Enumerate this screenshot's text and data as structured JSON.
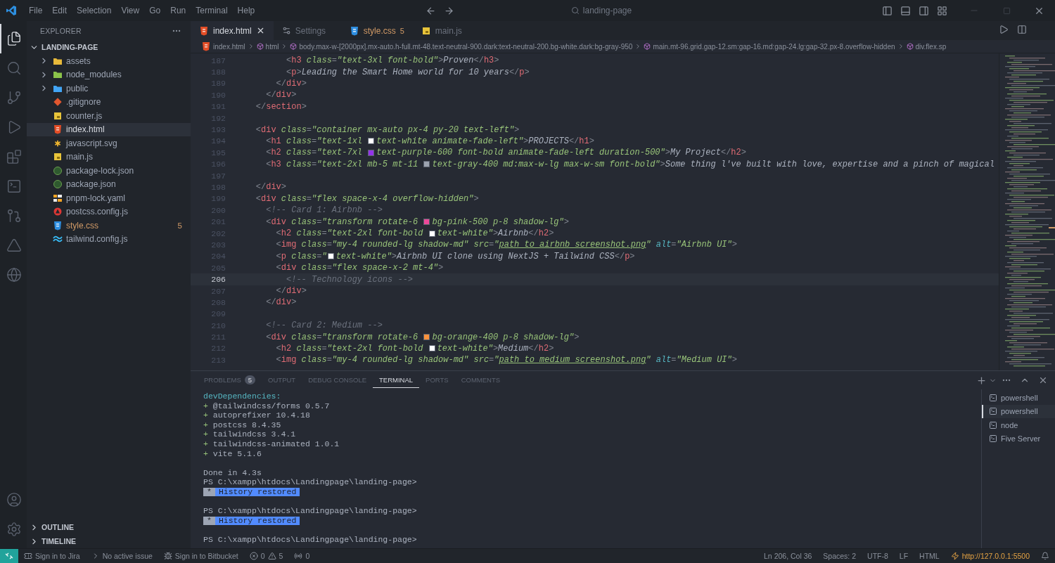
{
  "title_bar": {
    "menu": [
      "File",
      "Edit",
      "Selection",
      "View",
      "Go",
      "Run",
      "Terminal",
      "Help"
    ],
    "search": "landing-page"
  },
  "activity_bar": {
    "items": [
      {
        "selected": true
      },
      {
        "selected": false
      },
      {
        "selected": false
      },
      {
        "selected": false
      },
      {
        "selected": false
      },
      {
        "selected": false
      },
      {
        "selected": false
      },
      {
        "selected": false
      },
      {
        "selected": false
      }
    ]
  },
  "sidebar": {
    "title": "EXPLORER",
    "folder": {
      "name": "LANDING-PAGE",
      "expanded": true
    },
    "files": [
      {
        "kind": "folder",
        "name": "assets",
        "color": "#e8b93a",
        "expanded": false,
        "selected": false,
        "warning": false
      },
      {
        "kind": "folder",
        "name": "node_modules",
        "color": "#8bc34a",
        "expanded": false,
        "selected": false,
        "warning": false
      },
      {
        "kind": "folder",
        "name": "public",
        "color": "#42a5f5",
        "expanded": false,
        "selected": false,
        "warning": false
      },
      {
        "kind": "git",
        "name": ".gitignore",
        "selected": false,
        "warning": false
      },
      {
        "kind": "js",
        "name": "counter.js",
        "selected": false,
        "warning": false
      },
      {
        "kind": "html",
        "name": "index.html",
        "selected": true,
        "warning": false
      },
      {
        "kind": "svg",
        "name": "javascript.svg",
        "selected": false,
        "warning": false
      },
      {
        "kind": "js",
        "name": "main.js",
        "selected": false,
        "warning": false
      },
      {
        "kind": "json",
        "name": "package-lock.json",
        "selected": false,
        "warning": false
      },
      {
        "kind": "json",
        "name": "package.json",
        "selected": false,
        "warning": false
      },
      {
        "kind": "yaml",
        "name": "pnpm-lock.yaml",
        "selected": false,
        "warning": false
      },
      {
        "kind": "postcss",
        "name": "postcss.config.js",
        "selected": false,
        "warning": false
      },
      {
        "kind": "css",
        "name": "style.css",
        "badge": "5",
        "selected": false,
        "warning": true
      },
      {
        "kind": "tailwind",
        "name": "tailwind.config.js",
        "selected": false,
        "warning": false
      }
    ],
    "sections": [
      {
        "name": "OUTLINE",
        "expanded": false
      },
      {
        "name": "TIMELINE",
        "expanded": false
      }
    ]
  },
  "tabs": [
    {
      "kind": "html",
      "label": "index.html",
      "selected": true,
      "warning": false
    },
    {
      "kind": "settings",
      "label": "Settings",
      "selected": false,
      "warning": false
    },
    {
      "kind": "css",
      "label": "style.css",
      "badge": "5",
      "selected": false,
      "warning": true
    },
    {
      "kind": "js",
      "label": "main.js",
      "selected": false,
      "warning": false
    }
  ],
  "breadcrumb": [
    {
      "kind": "file",
      "text": "index.html"
    },
    {
      "kind": "element",
      "text": "html"
    },
    {
      "kind": "element",
      "text": "body.max-w-[2000px].mx-auto.h-full.mt-48.text-neutral-900.dark:text-neutral-200.bg-white.dark:bg-gray-950"
    },
    {
      "kind": "element",
      "text": "main.mt-96.grid.gap-12.sm:gap-16.md:gap-24.lg:gap-32.px-8.overflow-hidden"
    },
    {
      "kind": "element",
      "text": "div.flex.sp"
    }
  ],
  "code": {
    "lines": [
      {
        "number": "187",
        "current": false,
        "tokens": [
          {
            "kind": "punct",
            "text": "          <"
          },
          {
            "kind": "tag",
            "text": "h3"
          },
          {
            "kind": "attr",
            "text": " class"
          },
          {
            "kind": "punct",
            "text": "="
          },
          {
            "kind": "string",
            "text": "\"text-3xl font-bold\""
          },
          {
            "kind": "punct",
            "text": ">"
          },
          {
            "kind": "text",
            "text": "Proven"
          },
          {
            "kind": "punct",
            "text": "</"
          },
          {
            "kind": "tag",
            "text": "h3"
          },
          {
            "kind": "punct",
            "text": ">"
          }
        ]
      },
      {
        "number": "188",
        "current": false,
        "tokens": [
          {
            "kind": "punct",
            "text": "          <"
          },
          {
            "kind": "tag",
            "text": "p"
          },
          {
            "kind": "punct",
            "text": ">"
          },
          {
            "kind": "text",
            "text": "Leading the Smart Home world for 10 years"
          },
          {
            "kind": "punct",
            "text": "</"
          },
          {
            "kind": "tag",
            "text": "p"
          },
          {
            "kind": "punct",
            "text": ">"
          }
        ]
      },
      {
        "number": "189",
        "current": false,
        "tokens": [
          {
            "kind": "punct",
            "text": "        </"
          },
          {
            "kind": "tag",
            "text": "div"
          },
          {
            "kind": "punct",
            "text": ">"
          }
        ]
      },
      {
        "number": "190",
        "current": false,
        "tokens": [
          {
            "kind": "punct",
            "text": "      </"
          },
          {
            "kind": "tag",
            "text": "div"
          },
          {
            "kind": "punct",
            "text": ">"
          }
        ]
      },
      {
        "number": "191",
        "current": false,
        "tokens": [
          {
            "kind": "punct",
            "text": "    </"
          },
          {
            "kind": "tag",
            "text": "section"
          },
          {
            "kind": "punct",
            "text": ">"
          }
        ]
      },
      {
        "number": "192",
        "current": false
      },
      {
        "number": "193",
        "current": false,
        "tokens": [
          {
            "kind": "punct",
            "text": "    <"
          },
          {
            "kind": "tag",
            "text": "div"
          },
          {
            "kind": "attr",
            "text": " class"
          },
          {
            "kind": "punct",
            "text": "="
          },
          {
            "kind": "string",
            "text": "\"container mx-auto px-4 py-20 text-left\""
          },
          {
            "kind": "punct",
            "text": ">"
          }
        ]
      },
      {
        "number": "194",
        "current": false,
        "tokens": [
          {
            "kind": "punct",
            "text": "      <"
          },
          {
            "kind": "tag",
            "text": "h1"
          },
          {
            "kind": "attr",
            "text": " class"
          },
          {
            "kind": "punct",
            "text": "="
          },
          {
            "kind": "string",
            "text": "\"text-1xl "
          },
          {
            "kind": "swatch",
            "color": "#ffffff"
          },
          {
            "kind": "string",
            "text": "text-white animate-fade-left\""
          },
          {
            "kind": "punct",
            "text": ">"
          },
          {
            "kind": "text",
            "text": "PROJECTS"
          },
          {
            "kind": "punct",
            "text": "</"
          },
          {
            "kind": "tag",
            "text": "h1"
          },
          {
            "kind": "punct",
            "text": ">"
          }
        ]
      },
      {
        "number": "195",
        "current": false,
        "tokens": [
          {
            "kind": "punct",
            "text": "      <"
          },
          {
            "kind": "tag",
            "text": "h2"
          },
          {
            "kind": "attr",
            "text": " class"
          },
          {
            "kind": "punct",
            "text": "="
          },
          {
            "kind": "string",
            "text": "\"text-7xl "
          },
          {
            "kind": "swatch",
            "color": "#9333ea"
          },
          {
            "kind": "string",
            "text": "text-purple-600 font-bold animate-fade-left duration-500\""
          },
          {
            "kind": "punct",
            "text": ">"
          },
          {
            "kind": "text",
            "text": "My Project"
          },
          {
            "kind": "punct",
            "text": "</"
          },
          {
            "kind": "tag",
            "text": "h2"
          },
          {
            "kind": "punct",
            "text": ">"
          }
        ]
      },
      {
        "number": "196",
        "current": false,
        "tokens": [
          {
            "kind": "punct",
            "text": "      <"
          },
          {
            "kind": "tag",
            "text": "h3"
          },
          {
            "kind": "attr",
            "text": " class"
          },
          {
            "kind": "punct",
            "text": "="
          },
          {
            "kind": "string",
            "text": "\"text-2xl mb-5 mt-11 "
          },
          {
            "kind": "swatch",
            "color": "#9ca3af"
          },
          {
            "kind": "string",
            "text": "text-gray-400 md:max-w-lg max-w-sm font-bold\""
          },
          {
            "kind": "punct",
            "text": ">"
          },
          {
            "kind": "text",
            "text": "Some thing l've built with love, expertise and a pinch of magical"
          }
        ]
      },
      {
        "number": "197",
        "current": false
      },
      {
        "number": "198",
        "current": false,
        "tokens": [
          {
            "kind": "punct",
            "text": "    </"
          },
          {
            "kind": "tag",
            "text": "div"
          },
          {
            "kind": "punct",
            "text": ">"
          }
        ]
      },
      {
        "number": "199",
        "current": false,
        "tokens": [
          {
            "kind": "punct",
            "text": "    <"
          },
          {
            "kind": "tag",
            "text": "div"
          },
          {
            "kind": "attr",
            "text": " class"
          },
          {
            "kind": "punct",
            "text": "="
          },
          {
            "kind": "string",
            "text": "\"flex space-x-4 overflow-hidden\""
          },
          {
            "kind": "punct",
            "text": ">"
          }
        ]
      },
      {
        "number": "200",
        "current": false,
        "tokens": [
          {
            "kind": "comment",
            "text": "      <!-- Card 1: Airbnb -->"
          }
        ]
      },
      {
        "number": "201",
        "current": false,
        "tokens": [
          {
            "kind": "punct",
            "text": "      <"
          },
          {
            "kind": "tag",
            "text": "div"
          },
          {
            "kind": "attr",
            "text": " class"
          },
          {
            "kind": "punct",
            "text": "="
          },
          {
            "kind": "string",
            "text": "\"transform rotate-6 "
          },
          {
            "kind": "swatch",
            "color": "#ec4899"
          },
          {
            "kind": "string",
            "text": "bg-pink-500 p-8 shadow-lg\""
          },
          {
            "kind": "punct",
            "text": ">"
          }
        ]
      },
      {
        "number": "202",
        "current": false,
        "tokens": [
          {
            "kind": "punct",
            "text": "        <"
          },
          {
            "kind": "tag",
            "text": "h2"
          },
          {
            "kind": "attr",
            "text": " class"
          },
          {
            "kind": "punct",
            "text": "="
          },
          {
            "kind": "string",
            "text": "\"text-2xl font-bold "
          },
          {
            "kind": "swatch",
            "color": "#ffffff"
          },
          {
            "kind": "string",
            "text": "text-white\""
          },
          {
            "kind": "punct",
            "text": ">"
          },
          {
            "kind": "text",
            "text": "Airbnb"
          },
          {
            "kind": "punct",
            "text": "</"
          },
          {
            "kind": "tag",
            "text": "h2"
          },
          {
            "kind": "punct",
            "text": ">"
          }
        ]
      },
      {
        "number": "203",
        "current": false,
        "tokens": [
          {
            "kind": "punct",
            "text": "        <"
          },
          {
            "kind": "tag",
            "text": "img"
          },
          {
            "kind": "attr",
            "text": " class"
          },
          {
            "kind": "punct",
            "text": "="
          },
          {
            "kind": "string",
            "text": "\"my-4 rounded-lg shadow-md\""
          },
          {
            "kind": "attr",
            "text": " src"
          },
          {
            "kind": "punct",
            "text": "="
          },
          {
            "kind": "string",
            "text": "\""
          },
          {
            "kind": "path",
            "text": "path_to_airbnb_screenshot.png"
          },
          {
            "kind": "string",
            "text": "\""
          },
          {
            "kind": "alt",
            "text": " alt"
          },
          {
            "kind": "punct",
            "text": "="
          },
          {
            "kind": "string",
            "text": "\"Airbnb UI\""
          },
          {
            "kind": "punct",
            "text": ">"
          }
        ]
      },
      {
        "number": "204",
        "current": false,
        "tokens": [
          {
            "kind": "punct",
            "text": "        <"
          },
          {
            "kind": "tag",
            "text": "p"
          },
          {
            "kind": "attr",
            "text": " class"
          },
          {
            "kind": "punct",
            "text": "="
          },
          {
            "kind": "string",
            "text": "\""
          },
          {
            "kind": "swatch",
            "color": "#ffffff"
          },
          {
            "kind": "string",
            "text": "text-white\""
          },
          {
            "kind": "punct",
            "text": ">"
          },
          {
            "kind": "text",
            "text": "Airbnb UI clone using NextJS + Tailwind CSS"
          },
          {
            "kind": "punct",
            "text": "</"
          },
          {
            "kind": "tag",
            "text": "p"
          },
          {
            "kind": "punct",
            "text": ">"
          }
        ]
      },
      {
        "number": "205",
        "current": false,
        "tokens": [
          {
            "kind": "punct",
            "text": "        <"
          },
          {
            "kind": "tag",
            "text": "div"
          },
          {
            "kind": "attr",
            "text": " class"
          },
          {
            "kind": "punct",
            "text": "="
          },
          {
            "kind": "string",
            "text": "\"flex space-x-2 mt-4\""
          },
          {
            "kind": "punct",
            "text": ">"
          }
        ]
      },
      {
        "number": "206",
        "current": true,
        "tokens": [
          {
            "kind": "comment",
            "text": "          <!-- Technology icons -->"
          }
        ]
      },
      {
        "number": "207",
        "current": false,
        "tokens": [
          {
            "kind": "punct",
            "text": "        </"
          },
          {
            "kind": "tag",
            "text": "div"
          },
          {
            "kind": "punct",
            "text": ">"
          }
        ]
      },
      {
        "number": "208",
        "current": false,
        "tokens": [
          {
            "kind": "punct",
            "text": "      </"
          },
          {
            "kind": "tag",
            "text": "div"
          },
          {
            "kind": "punct",
            "text": ">"
          }
        ]
      },
      {
        "number": "209",
        "current": false
      },
      {
        "number": "210",
        "current": false,
        "tokens": [
          {
            "kind": "comment",
            "text": "      <!-- Card 2: Medium -->"
          }
        ]
      },
      {
        "number": "211",
        "current": false,
        "tokens": [
          {
            "kind": "punct",
            "text": "      <"
          },
          {
            "kind": "tag",
            "text": "div"
          },
          {
            "kind": "attr",
            "text": " class"
          },
          {
            "kind": "punct",
            "text": "="
          },
          {
            "kind": "string",
            "text": "\"transform rotate-6 "
          },
          {
            "kind": "swatch",
            "color": "#fb923c"
          },
          {
            "kind": "string",
            "text": "bg-orange-400 p-8 shadow-lg\""
          },
          {
            "kind": "punct",
            "text": ">"
          }
        ]
      },
      {
        "number": "212",
        "current": false,
        "tokens": [
          {
            "kind": "punct",
            "text": "        <"
          },
          {
            "kind": "tag",
            "text": "h2"
          },
          {
            "kind": "attr",
            "text": " class"
          },
          {
            "kind": "punct",
            "text": "="
          },
          {
            "kind": "string",
            "text": "\"text-2xl font-bold "
          },
          {
            "kind": "swatch",
            "color": "#ffffff"
          },
          {
            "kind": "string",
            "text": "text-white\""
          },
          {
            "kind": "punct",
            "text": ">"
          },
          {
            "kind": "text",
            "text": "Medium"
          },
          {
            "kind": "punct",
            "text": "</"
          },
          {
            "kind": "tag",
            "text": "h2"
          },
          {
            "kind": "punct",
            "text": ">"
          }
        ]
      },
      {
        "number": "213",
        "current": false,
        "tokens": [
          {
            "kind": "punct",
            "text": "        <"
          },
          {
            "kind": "tag",
            "text": "img"
          },
          {
            "kind": "attr",
            "text": " class"
          },
          {
            "kind": "punct",
            "text": "="
          },
          {
            "kind": "string",
            "text": "\"my-4 rounded-lg shadow-md\""
          },
          {
            "kind": "attr",
            "text": " src"
          },
          {
            "kind": "punct",
            "text": "="
          },
          {
            "kind": "string",
            "text": "\""
          },
          {
            "kind": "path",
            "text": "path_to_medium_screenshot.png"
          },
          {
            "kind": "string",
            "text": "\""
          },
          {
            "kind": "alt",
            "text": " alt"
          },
          {
            "kind": "punct",
            "text": "="
          },
          {
            "kind": "string",
            "text": "\"Medium UI\""
          },
          {
            "kind": "punct",
            "text": ">"
          }
        ]
      }
    ]
  },
  "panel": {
    "tabs": [
      {
        "label": "PROBLEMS",
        "badge": "5",
        "selected": false
      },
      {
        "label": "OUTPUT",
        "selected": false
      },
      {
        "label": "DEBUG CONSOLE",
        "selected": false
      },
      {
        "label": "TERMINAL",
        "selected": true
      },
      {
        "label": "PORTS",
        "selected": false
      },
      {
        "label": "COMMENTS",
        "selected": false
      }
    ],
    "terminal_lines": [
      {
        "kind": "heading",
        "text": "devDependencies:"
      },
      {
        "kind": "added",
        "mark": "+",
        "text": "@tailwindcss/forms 0.5.7"
      },
      {
        "kind": "added",
        "mark": "+",
        "text": "autoprefixer 10.4.18"
      },
      {
        "kind": "added",
        "mark": "+",
        "text": "postcss 8.4.35"
      },
      {
        "kind": "added",
        "mark": "+",
        "text": "tailwindcss 3.4.1"
      },
      {
        "kind": "added",
        "mark": "+",
        "text": "tailwindcss-animated 1.0.1"
      },
      {
        "kind": "added",
        "mark": "+",
        "text": "vite 5.1.6"
      },
      {
        "kind": "blank"
      },
      {
        "kind": "plain",
        "text": "Done in 4.3s"
      },
      {
        "kind": "plain",
        "text": "PS C:\\xampp\\htdocs\\Landingpage\\landing-page>"
      },
      {
        "kind": "notice",
        "mark": "*",
        "text": "History restored"
      },
      {
        "kind": "blank"
      },
      {
        "kind": "plain",
        "text": "PS C:\\xampp\\htdocs\\Landingpage\\landing-page>"
      },
      {
        "kind": "notice",
        "mark": "*",
        "text": "History restored"
      },
      {
        "kind": "blank"
      },
      {
        "kind": "plain",
        "text": "PS C:\\xampp\\htdocs\\Landingpage\\landing-page>"
      }
    ],
    "terminals": [
      {
        "name": "powershell",
        "selected": false
      },
      {
        "name": "powershell",
        "selected": true
      },
      {
        "name": "node",
        "selected": false
      },
      {
        "name": "Five Server",
        "selected": false
      }
    ]
  },
  "status_bar": {
    "left": [
      {
        "kind": "remote"
      },
      {
        "kind": "jira",
        "text": "Sign in to Jira"
      },
      {
        "kind": "issue",
        "text": "No active issue"
      },
      {
        "kind": "bitbucket",
        "text": "Sign in to Bitbucket"
      },
      {
        "kind": "problems",
        "errors": "0",
        "warnings": "5"
      },
      {
        "kind": "ports",
        "text": "0"
      }
    ],
    "right": [
      {
        "kind": "position",
        "text": "Ln 206, Col 36"
      },
      {
        "kind": "spaces",
        "text": "Spaces: 2"
      },
      {
        "kind": "encoding",
        "text": "UTF-8"
      },
      {
        "kind": "eol",
        "text": "LF"
      },
      {
        "kind": "language",
        "text": "HTML"
      },
      {
        "kind": "server",
        "text": "http://127.0.0.1:5500"
      },
      {
        "kind": "bell"
      }
    ]
  }
}
